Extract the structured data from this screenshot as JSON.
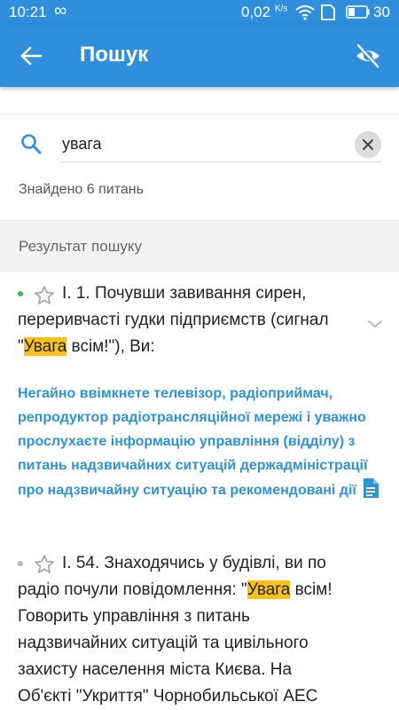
{
  "status_bar": {
    "time": "10:21",
    "infinity": "∞",
    "speed_value": "0,02",
    "speed_unit": "K/s",
    "battery": "30"
  },
  "app_bar": {
    "title": "Пошук",
    "back_icon": "arrow-left-icon",
    "visibility_icon": "eye-off-icon",
    "color": "#2f8fdc"
  },
  "search": {
    "value": "увага",
    "placeholder": "",
    "found_text": "Знайдено 6 питань"
  },
  "results_header": "Результат пошуку",
  "results": [
    {
      "dot_color": "#3cb44b",
      "q_before": "І. 1. Почувши завивання сирен, переривчасті гудки підприємств (сигнал \"",
      "q_highlight": "Увага",
      "q_after": " всім!\"), Ви:",
      "answer": "Негайно ввімкнете телевізор, радіоприймач, репродуктор радіотрансляційної мережі і уважно прослухаєте інформацію управління (відділу) з питань надзвичайних ситуацій держадміністрації про надзвичайну ситуацію та рекомендовані дії"
    },
    {
      "dot_color": "#b5b5b5",
      "q_before": "І. 54. Знаходячись у будівлі, ви по радіо почули повідомлення: \"",
      "q_highlight": "Увага",
      "q_after": " всім! Говорить управління з питань надзвичайних ситуацій та цивільного захисту населення міста Києва. На Об'єкті \"Укриття\" Чорнобильської АЕС"
    }
  ],
  "colors": {
    "accent": "#2f8fdc",
    "answer_text": "#2f93d6",
    "highlight": "#f8c21a"
  }
}
